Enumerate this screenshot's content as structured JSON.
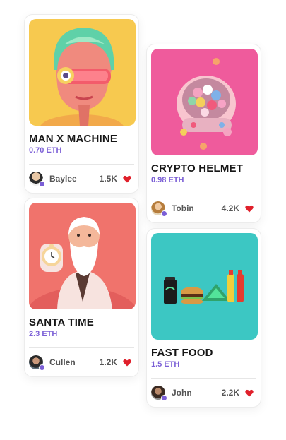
{
  "cards": [
    {
      "title": "MAN X MACHINE",
      "price": "0.70 ETH",
      "owner": "Baylee",
      "likes": "1.5K",
      "avatar_icon": "user-avatar",
      "like_icon": "heart-icon",
      "art_bg": "#f7c94f"
    },
    {
      "title": "CRYPTO HELMET",
      "price": "0.98 ETH",
      "owner": "Tobin",
      "likes": "4.2K",
      "avatar_icon": "user-avatar",
      "like_icon": "heart-icon",
      "art_bg": "#ef5b9c"
    },
    {
      "title": "SANTA TIME",
      "price": "2.3 ETH",
      "owner": "Cullen",
      "likes": "1.2K",
      "avatar_icon": "user-avatar",
      "like_icon": "heart-icon",
      "art_bg": "#f0736c"
    },
    {
      "title": "FAST FOOD",
      "price": "1.5 ETH",
      "owner": "John",
      "likes": "2.2K",
      "avatar_icon": "user-avatar",
      "like_icon": "heart-icon",
      "art_bg": "#3cc7c3"
    }
  ],
  "colors": {
    "accent": "#7b5fd6",
    "heart": "#e0202b"
  }
}
